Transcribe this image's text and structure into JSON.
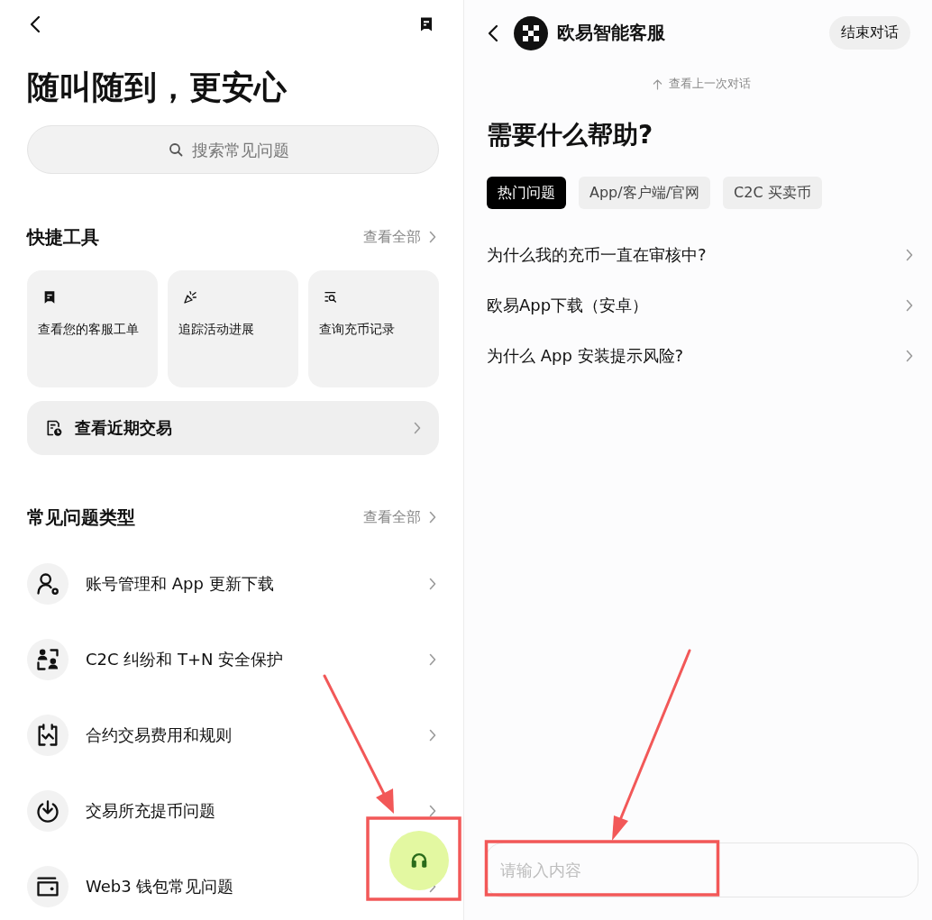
{
  "left_screen": {
    "title": "随叫随到，更安心",
    "search": {
      "placeholder": "搜索常见问题"
    },
    "quick_tools": {
      "heading": "快捷工具",
      "view_all": "查看全部",
      "cards": [
        {
          "kind": "ticket",
          "label": "查看您的客服工单"
        },
        {
          "kind": "party",
          "label": "追踪活动进展"
        },
        {
          "kind": "deposit-search",
          "label": "查询充币记录"
        }
      ],
      "wide_card": {
        "kind": "history",
        "label": "查看近期交易"
      }
    },
    "faq_types": {
      "heading": "常见问题类型",
      "view_all": "查看全部",
      "items": [
        {
          "kind": "account",
          "label": "账号管理和 App 更新下载"
        },
        {
          "kind": "c2c",
          "label": "C2C 纠纷和 T+N 安全保护"
        },
        {
          "kind": "contract",
          "label": "合约交易费用和规则"
        },
        {
          "kind": "deposit",
          "label": "交易所充提币问题"
        },
        {
          "kind": "wallet",
          "label": "Web3 钱包常见问题"
        }
      ]
    }
  },
  "right_screen": {
    "title": "欧易智能客服",
    "end_button": "结束对话",
    "history_link": "查看上一次对话",
    "heading": "需要什么帮助?",
    "tabs": [
      {
        "label": "热门问题",
        "selected": true
      },
      {
        "label": "App/客户端/官网",
        "selected": false
      },
      {
        "label": "C2C 买卖币",
        "selected": false
      }
    ],
    "questions": [
      {
        "label": "为什么我的充币一直在审核中?"
      },
      {
        "label": "欧易App下载（安卓）"
      },
      {
        "label": "为什么 App 安装提示风险?"
      }
    ],
    "input": {
      "placeholder": "请输入内容"
    }
  }
}
